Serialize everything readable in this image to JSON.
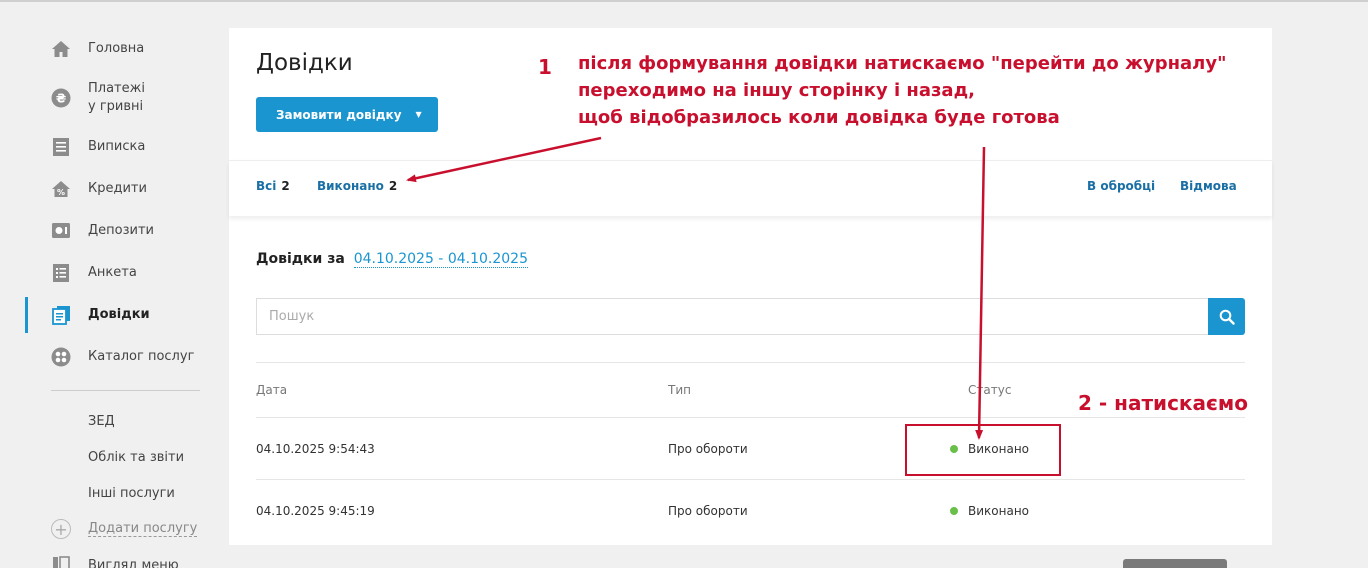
{
  "sidebar": {
    "items": [
      {
        "label": "Головна",
        "icon": "home-icon"
      },
      {
        "label": "Платежі у гривні",
        "icon": "hryvnia-icon"
      },
      {
        "label": "Виписка",
        "icon": "statement-icon"
      },
      {
        "label": "Кредити",
        "icon": "credit-icon"
      },
      {
        "label": "Депозити",
        "icon": "deposit-icon"
      },
      {
        "label": "Анкета",
        "icon": "form-icon"
      },
      {
        "label": "Довідки",
        "icon": "certificates-icon",
        "active": true
      },
      {
        "label": "Каталог послуг",
        "icon": "catalog-icon"
      }
    ],
    "extra_items": [
      "ЗЕД",
      "Облік та звіти",
      "Інші послуги"
    ],
    "add_service": "Додати послугу",
    "view_menu": "Вигляд меню"
  },
  "main": {
    "title": "Довідки",
    "order_button": "Замовити довідку",
    "tabs": [
      {
        "label": "Всі",
        "count": "2"
      },
      {
        "label": "Виконано",
        "count": "2"
      },
      {
        "label": "В обробці",
        "count": ""
      },
      {
        "label": "Відмова",
        "count": ""
      }
    ],
    "period_label": "Довідки за",
    "period_range": "04.10.2025 - 04.10.2025",
    "search_placeholder": "Пошук",
    "table": {
      "headers": [
        "Дата",
        "Тип",
        "Статус"
      ],
      "rows": [
        {
          "date": "04.10.2025 9:54:43",
          "type": "Про обороти",
          "status": "Виконано"
        },
        {
          "date": "04.10.2025 9:45:19",
          "type": "Про обороти",
          "status": "Виконано"
        }
      ]
    }
  },
  "annotations": {
    "step1_number": "1",
    "step1_lines": [
      "після формування довідки натискаємо \"перейти до журналу\"",
      "переходимо на іншу сторінку і назад,",
      "щоб відобразилось коли довідка буде готова"
    ],
    "step2": "2 - натискаємо"
  },
  "colors": {
    "accent": "#1a95d0",
    "annotation": "#c8102e",
    "status_done": "#6abf4b"
  }
}
